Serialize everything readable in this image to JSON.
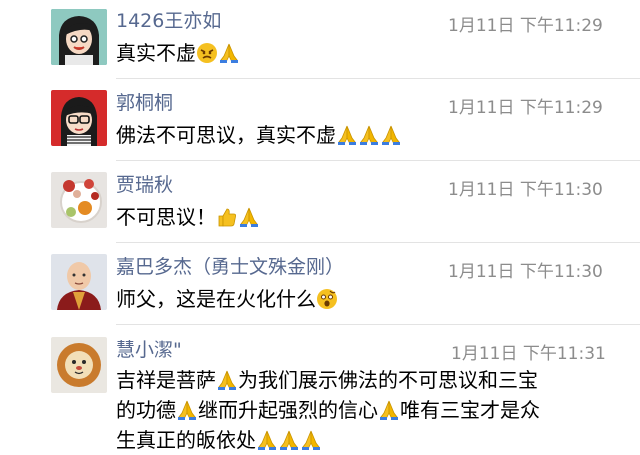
{
  "messages": [
    {
      "name": "1426王亦如",
      "time": "1月11日 下午11:29",
      "parts": [
        {
          "t": "真实不虚"
        },
        {
          "icon": "angry-face-emoji"
        },
        {
          "icon": "praying-hands-emoji"
        }
      ]
    },
    {
      "name": "郭桐桐",
      "time": "1月11日 下午11:29",
      "parts": [
        {
          "t": "佛法不可思议，真实不虚"
        },
        {
          "icon": "praying-hands-emoji"
        },
        {
          "icon": "praying-hands-emoji"
        },
        {
          "icon": "praying-hands-emoji"
        }
      ]
    },
    {
      "name": "贾瑞秋",
      "time": "1月11日 下午11:30",
      "parts": [
        {
          "t": "不可思议！"
        },
        {
          "icon": "thumbs-up-emoji"
        },
        {
          "icon": "praying-hands-emoji"
        }
      ]
    },
    {
      "name": "嘉巴多杰（勇士文殊金刚）",
      "time": "1月11日 下午11:30",
      "parts": [
        {
          "t": "师父，这是在火化什么"
        },
        {
          "icon": "shocked-face-emoji"
        }
      ]
    },
    {
      "name": "慧小潔\"",
      "time": "1月11日 下午11:31",
      "lines": [
        [
          {
            "t": "吉祥是菩萨"
          },
          {
            "icon": "praying-hands-emoji"
          },
          {
            "t": "为我们展示佛法的不可思议和三宝"
          }
        ],
        [
          {
            "t": "的功德"
          },
          {
            "icon": "praying-hands-emoji"
          },
          {
            "t": "继而升起强烈的信心"
          },
          {
            "icon": "praying-hands-emoji"
          },
          {
            "t": "唯有三宝才是众"
          }
        ],
        [
          {
            "t": "生真正的皈依处"
          },
          {
            "icon": "praying-hands-emoji"
          },
          {
            "icon": "praying-hands-emoji"
          },
          {
            "icon": "praying-hands-emoji"
          }
        ]
      ]
    }
  ],
  "colors": {
    "name": "#56688f",
    "time": "#8c8c8c",
    "divider": "#e3e3e3",
    "emoji_yellow": "#f5c020"
  }
}
